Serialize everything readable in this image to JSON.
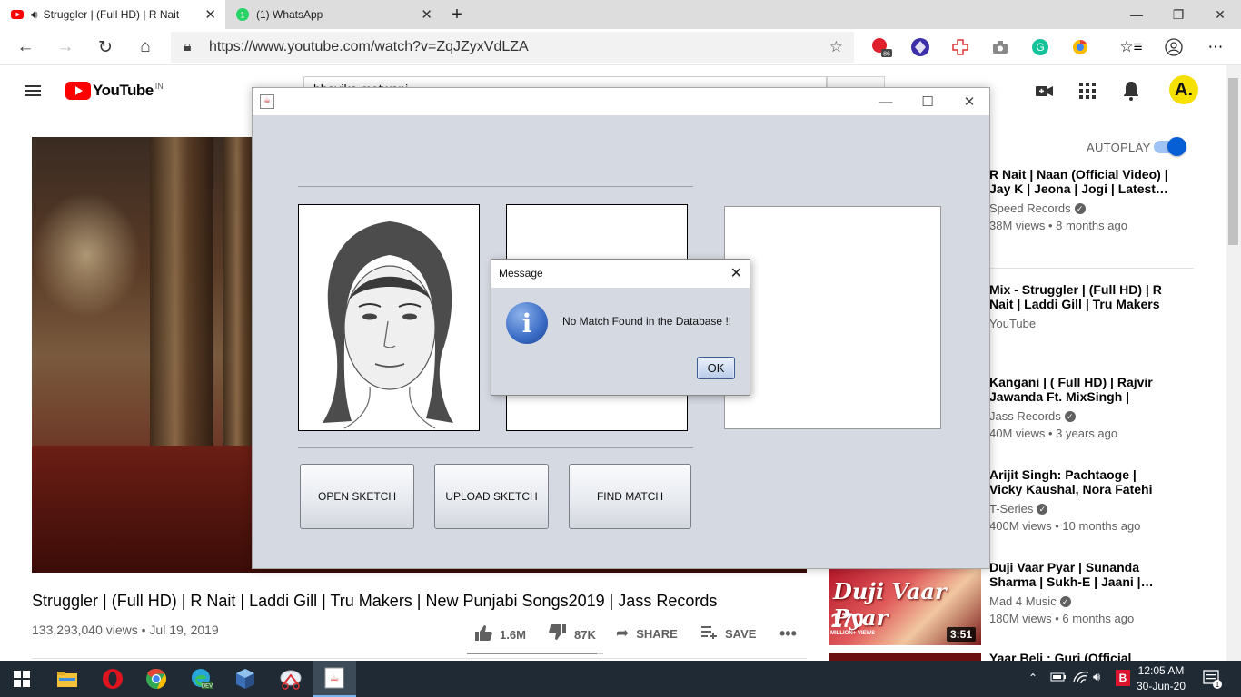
{
  "browser": {
    "tabs": [
      {
        "title": "Struggler | (Full HD) | R Nait",
        "active": true
      },
      {
        "title": "(1) WhatsApp",
        "active": false
      }
    ],
    "url": "https://www.youtube.com/watch?v=ZqJZyxVdLZA",
    "extension_badge": "86"
  },
  "youtube": {
    "logo_text": "YouTube",
    "region": "IN",
    "search_value": "bhavika motwani",
    "avatar_letter": "A.",
    "video": {
      "title": "Struggler | (Full HD) | R Nait | Laddi Gill | Tru Makers | New Punjabi Songs2019 | Jass Records",
      "views_date": "133,293,040 views • Jul 19, 2019",
      "likes": "1.6M",
      "dislikes": "87K",
      "share": "SHARE",
      "save": "SAVE",
      "like_ratio": 0.95
    },
    "autoplay": {
      "label": "AUTOPLAY",
      "on": true
    },
    "recommendations": [
      {
        "title": "R Nait | Naan (Official Video) | Jay K | Jeona | Jogi | Latest…",
        "channel": "Speed Records",
        "verified": true,
        "meta": "38M views • 8 months ago"
      },
      {
        "title": "Mix - Struggler | (Full HD) | R Nait | Laddi Gill | Tru Makers |…",
        "channel": "YouTube",
        "verified": false,
        "meta": ""
      },
      {
        "title": "Kangani | ( Full HD) | Rajvir Jawanda Ft. MixSingh | New…",
        "channel": "Jass Records",
        "verified": true,
        "meta": "40M views • 3 years ago"
      },
      {
        "title": "Arijit Singh: Pachtaoge | Vicky Kaushal, Nora Fatehi |Jaani, B…",
        "channel": "T-Series",
        "verified": true,
        "meta": "400M views • 10 months ago"
      },
      {
        "title": "Duji Vaar Pyar | Sunanda Sharma | Sukh-E | Jaani |…",
        "channel": "Mad 4 Music",
        "verified": true,
        "meta": "180M views • 6 months ago"
      },
      {
        "title": "Yaar Beli : Guri (Official Video)…",
        "channel": "",
        "verified": false,
        "meta": ""
      }
    ],
    "thumbnail": {
      "script_text": "Duji Vaar Pyar",
      "views_text": "170",
      "views_caption": "MILLION+ VIEWS",
      "duration": "3:51"
    }
  },
  "swing_app": {
    "buttons": {
      "open": "OPEN SKETCH",
      "upload": "UPLOAD SKETCH",
      "find": "FIND MATCH"
    }
  },
  "dialog": {
    "title": "Message",
    "message": "No Match Found in the Database !!",
    "ok_label": "OK"
  },
  "taskbar": {
    "time": "12:05 AM",
    "date": "30-Jun-20",
    "notification_count": "1"
  }
}
